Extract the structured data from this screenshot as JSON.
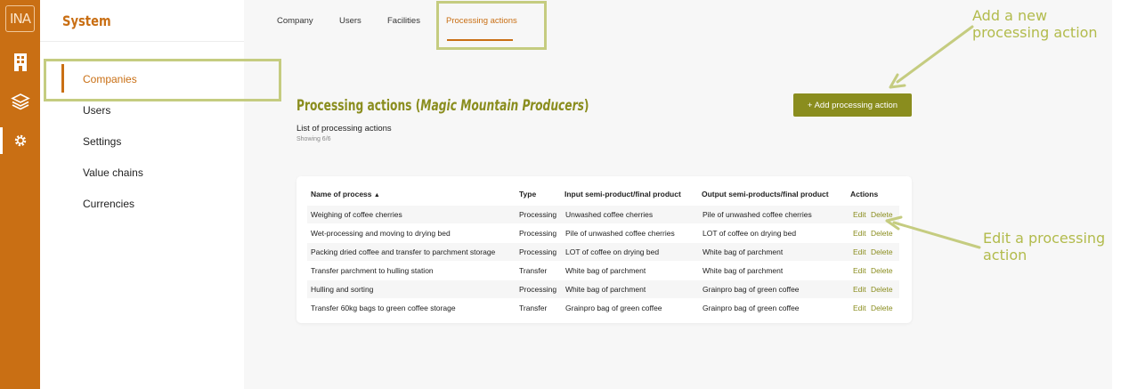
{
  "app": {
    "logo_text": "INA",
    "section_title": "System"
  },
  "rail": {
    "icons": [
      "building-icon",
      "layers-icon",
      "gear-icon"
    ]
  },
  "sidebar": {
    "items": [
      {
        "label": "Companies",
        "active": true
      },
      {
        "label": "Users"
      },
      {
        "label": "Settings"
      },
      {
        "label": "Value chains"
      },
      {
        "label": "Currencies"
      }
    ]
  },
  "tabs": [
    {
      "label": "Company"
    },
    {
      "label": "Users"
    },
    {
      "label": "Facilities"
    },
    {
      "label": "Processing actions",
      "active": true
    }
  ],
  "page": {
    "title_prefix": "Processing actions (",
    "company": "Magic Mountain Producers",
    "title_suffix": ")",
    "subtitle": "List of processing actions",
    "showing": "Showing 6/6",
    "add_button": "+ Add processing action"
  },
  "table": {
    "headers": {
      "name": "Name of process",
      "type": "Type",
      "input": "Input semi-product/final product",
      "output": "Output semi-products/final product",
      "actions": "Actions"
    },
    "edit_label": "Edit",
    "delete_label": "Delete",
    "rows": [
      {
        "name": "Weighing of coffee cherries",
        "type": "Processing",
        "input": "Unwashed coffee cherries",
        "output": "Pile of unwashed coffee cherries"
      },
      {
        "name": "Wet-processing and moving to drying bed",
        "type": "Processing",
        "input": "Pile of unwashed coffee cherries",
        "output": "LOT of coffee on drying bed"
      },
      {
        "name": "Packing dried coffee and transfer to parchment storage",
        "type": "Processing",
        "input": "LOT of coffee on drying bed",
        "output": "White bag of parchment"
      },
      {
        "name": "Transfer parchment to hulling station",
        "type": "Transfer",
        "input": "White bag of parchment",
        "output": "White bag of parchment"
      },
      {
        "name": "Hulling and sorting",
        "type": "Processing",
        "input": "White bag of parchment",
        "output": "Grainpro bag of green coffee"
      },
      {
        "name": "Transfer 60kg bags to green coffee storage",
        "type": "Transfer",
        "input": "Grainpro bag of green coffee",
        "output": "Grainpro bag of green coffee"
      }
    ]
  },
  "annotations": {
    "add_note_line1": "Add a new",
    "add_note_line2": "processing action",
    "edit_note_line1": "Edit a processing",
    "edit_note_line2": "action"
  },
  "colors": {
    "brand_orange": "#c96f14",
    "accent_olive": "#8a8d1e",
    "annotation_green": "#c5cc80"
  }
}
